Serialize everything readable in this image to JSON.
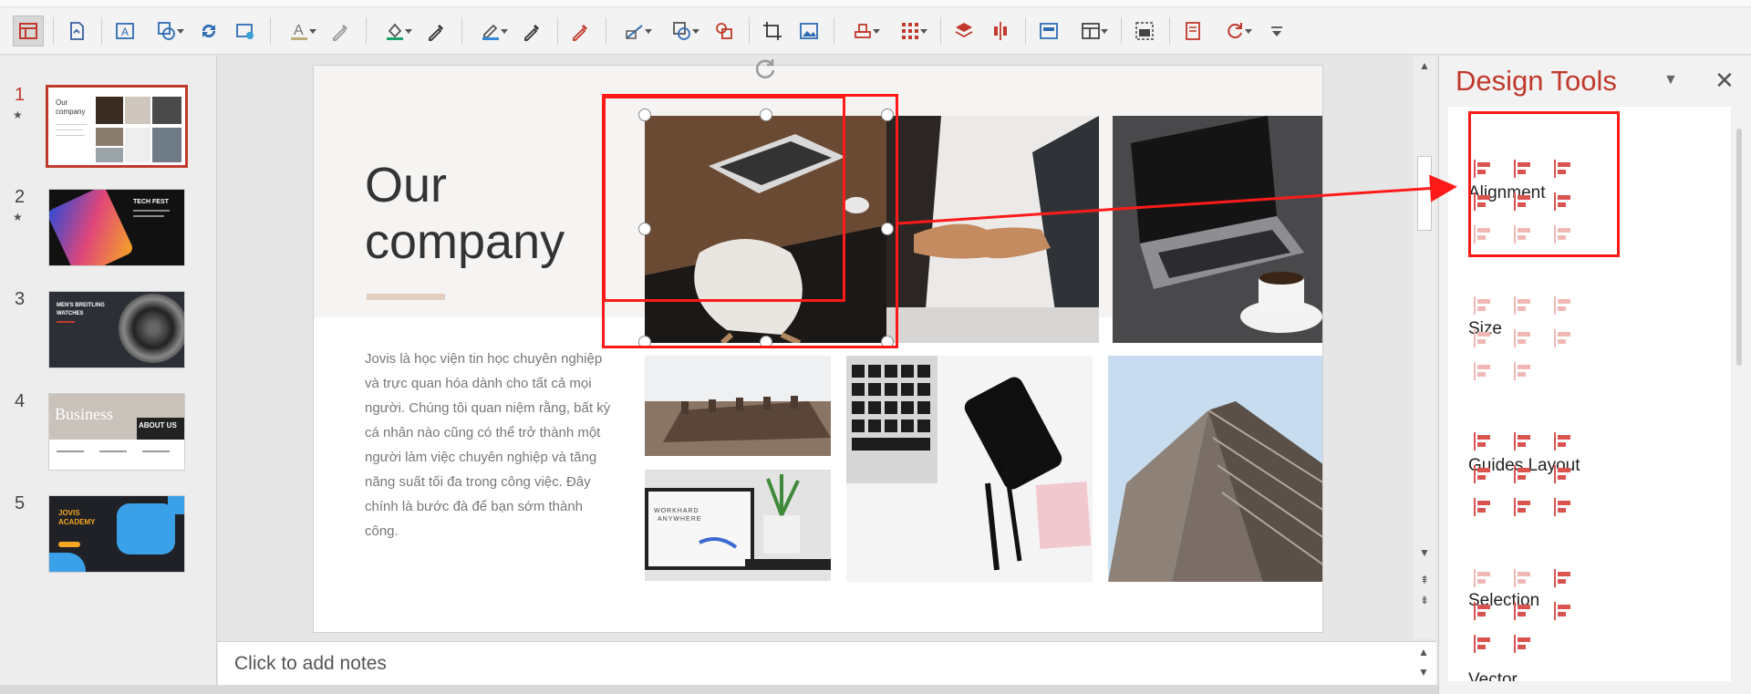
{
  "thumbnails": [
    {
      "number": "1",
      "label_lines": [
        "Our",
        "company"
      ],
      "active": true,
      "has_star": true
    },
    {
      "number": "2",
      "label_lines": [
        "TECH FEST"
      ],
      "active": false,
      "has_star": true
    },
    {
      "number": "3",
      "label_lines": [
        "MEN'S BREITLING",
        "WATCHES"
      ],
      "active": false,
      "has_star": false
    },
    {
      "number": "4",
      "label_lines": [
        "Business",
        "ABOUT US"
      ],
      "active": false,
      "has_star": false
    },
    {
      "number": "5",
      "label_lines": [
        "JOVIS",
        "ACADEMY"
      ],
      "active": false,
      "has_star": false
    }
  ],
  "star_glyph": "★",
  "slide": {
    "title_line1": "Our",
    "title_line2": "company",
    "body": "Jovis là học viện tin học chuyên nghiệp và trực quan hóa dành cho tất cả mọi người. Chúng tôi quan niệm rằng, bất kỳ cá nhân nào cũng có thể trở thành một người làm việc chuyên nghiệp và tăng năng suất tối đa trong công việc. Đây chính là bước đà để bạn sớm thành công.",
    "photo_text": [
      "WORKHARD",
      "ANYWHERE"
    ]
  },
  "notes_placeholder": "Click to add notes",
  "pane": {
    "title": "Design Tools",
    "close_glyph": "✕",
    "dropdown_glyph": "▼",
    "sections": {
      "alignment": "Alignment",
      "size": "Size",
      "guides": "Guides Layout",
      "selection": "Selection",
      "vector_partial": "Vector"
    }
  },
  "colors": {
    "accent": "#c0392b",
    "highlight": "#ff1a1a",
    "icon": "#d9534f",
    "icon_faded": "#f0b8b5"
  },
  "scroll_glyphs": {
    "up": "▲",
    "down": "▼",
    "prev": "⇞",
    "next": "⇟"
  }
}
